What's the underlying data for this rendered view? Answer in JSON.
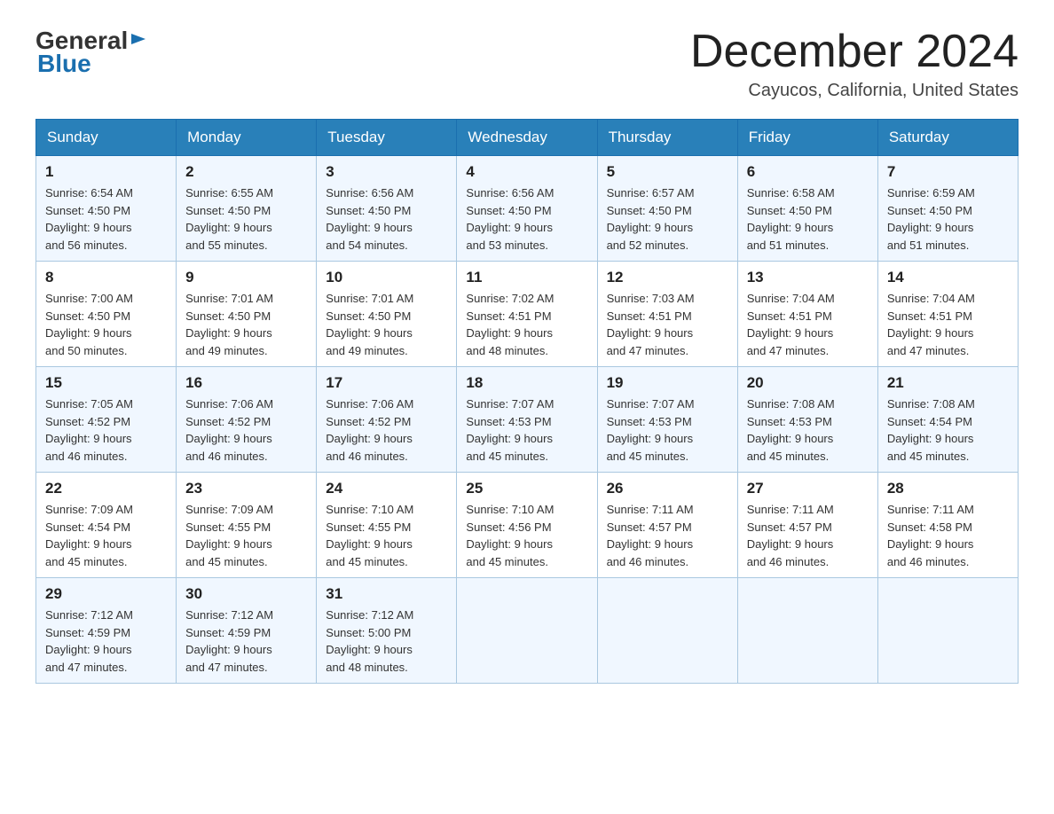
{
  "header": {
    "logo_general": "General",
    "logo_blue": "Blue",
    "month_title": "December 2024",
    "location": "Cayucos, California, United States"
  },
  "days_of_week": [
    "Sunday",
    "Monday",
    "Tuesday",
    "Wednesday",
    "Thursday",
    "Friday",
    "Saturday"
  ],
  "weeks": [
    [
      {
        "day": "1",
        "sunrise": "6:54 AM",
        "sunset": "4:50 PM",
        "daylight": "9 hours and 56 minutes."
      },
      {
        "day": "2",
        "sunrise": "6:55 AM",
        "sunset": "4:50 PM",
        "daylight": "9 hours and 55 minutes."
      },
      {
        "day": "3",
        "sunrise": "6:56 AM",
        "sunset": "4:50 PM",
        "daylight": "9 hours and 54 minutes."
      },
      {
        "day": "4",
        "sunrise": "6:56 AM",
        "sunset": "4:50 PM",
        "daylight": "9 hours and 53 minutes."
      },
      {
        "day": "5",
        "sunrise": "6:57 AM",
        "sunset": "4:50 PM",
        "daylight": "9 hours and 52 minutes."
      },
      {
        "day": "6",
        "sunrise": "6:58 AM",
        "sunset": "4:50 PM",
        "daylight": "9 hours and 51 minutes."
      },
      {
        "day": "7",
        "sunrise": "6:59 AM",
        "sunset": "4:50 PM",
        "daylight": "9 hours and 51 minutes."
      }
    ],
    [
      {
        "day": "8",
        "sunrise": "7:00 AM",
        "sunset": "4:50 PM",
        "daylight": "9 hours and 50 minutes."
      },
      {
        "day": "9",
        "sunrise": "7:01 AM",
        "sunset": "4:50 PM",
        "daylight": "9 hours and 49 minutes."
      },
      {
        "day": "10",
        "sunrise": "7:01 AM",
        "sunset": "4:50 PM",
        "daylight": "9 hours and 49 minutes."
      },
      {
        "day": "11",
        "sunrise": "7:02 AM",
        "sunset": "4:51 PM",
        "daylight": "9 hours and 48 minutes."
      },
      {
        "day": "12",
        "sunrise": "7:03 AM",
        "sunset": "4:51 PM",
        "daylight": "9 hours and 47 minutes."
      },
      {
        "day": "13",
        "sunrise": "7:04 AM",
        "sunset": "4:51 PM",
        "daylight": "9 hours and 47 minutes."
      },
      {
        "day": "14",
        "sunrise": "7:04 AM",
        "sunset": "4:51 PM",
        "daylight": "9 hours and 47 minutes."
      }
    ],
    [
      {
        "day": "15",
        "sunrise": "7:05 AM",
        "sunset": "4:52 PM",
        "daylight": "9 hours and 46 minutes."
      },
      {
        "day": "16",
        "sunrise": "7:06 AM",
        "sunset": "4:52 PM",
        "daylight": "9 hours and 46 minutes."
      },
      {
        "day": "17",
        "sunrise": "7:06 AM",
        "sunset": "4:52 PM",
        "daylight": "9 hours and 46 minutes."
      },
      {
        "day": "18",
        "sunrise": "7:07 AM",
        "sunset": "4:53 PM",
        "daylight": "9 hours and 45 minutes."
      },
      {
        "day": "19",
        "sunrise": "7:07 AM",
        "sunset": "4:53 PM",
        "daylight": "9 hours and 45 minutes."
      },
      {
        "day": "20",
        "sunrise": "7:08 AM",
        "sunset": "4:53 PM",
        "daylight": "9 hours and 45 minutes."
      },
      {
        "day": "21",
        "sunrise": "7:08 AM",
        "sunset": "4:54 PM",
        "daylight": "9 hours and 45 minutes."
      }
    ],
    [
      {
        "day": "22",
        "sunrise": "7:09 AM",
        "sunset": "4:54 PM",
        "daylight": "9 hours and 45 minutes."
      },
      {
        "day": "23",
        "sunrise": "7:09 AM",
        "sunset": "4:55 PM",
        "daylight": "9 hours and 45 minutes."
      },
      {
        "day": "24",
        "sunrise": "7:10 AM",
        "sunset": "4:55 PM",
        "daylight": "9 hours and 45 minutes."
      },
      {
        "day": "25",
        "sunrise": "7:10 AM",
        "sunset": "4:56 PM",
        "daylight": "9 hours and 45 minutes."
      },
      {
        "day": "26",
        "sunrise": "7:11 AM",
        "sunset": "4:57 PM",
        "daylight": "9 hours and 46 minutes."
      },
      {
        "day": "27",
        "sunrise": "7:11 AM",
        "sunset": "4:57 PM",
        "daylight": "9 hours and 46 minutes."
      },
      {
        "day": "28",
        "sunrise": "7:11 AM",
        "sunset": "4:58 PM",
        "daylight": "9 hours and 46 minutes."
      }
    ],
    [
      {
        "day": "29",
        "sunrise": "7:12 AM",
        "sunset": "4:59 PM",
        "daylight": "9 hours and 47 minutes."
      },
      {
        "day": "30",
        "sunrise": "7:12 AM",
        "sunset": "4:59 PM",
        "daylight": "9 hours and 47 minutes."
      },
      {
        "day": "31",
        "sunrise": "7:12 AM",
        "sunset": "5:00 PM",
        "daylight": "9 hours and 48 minutes."
      },
      null,
      null,
      null,
      null
    ]
  ],
  "labels": {
    "sunrise": "Sunrise:",
    "sunset": "Sunset:",
    "daylight": "Daylight:"
  }
}
